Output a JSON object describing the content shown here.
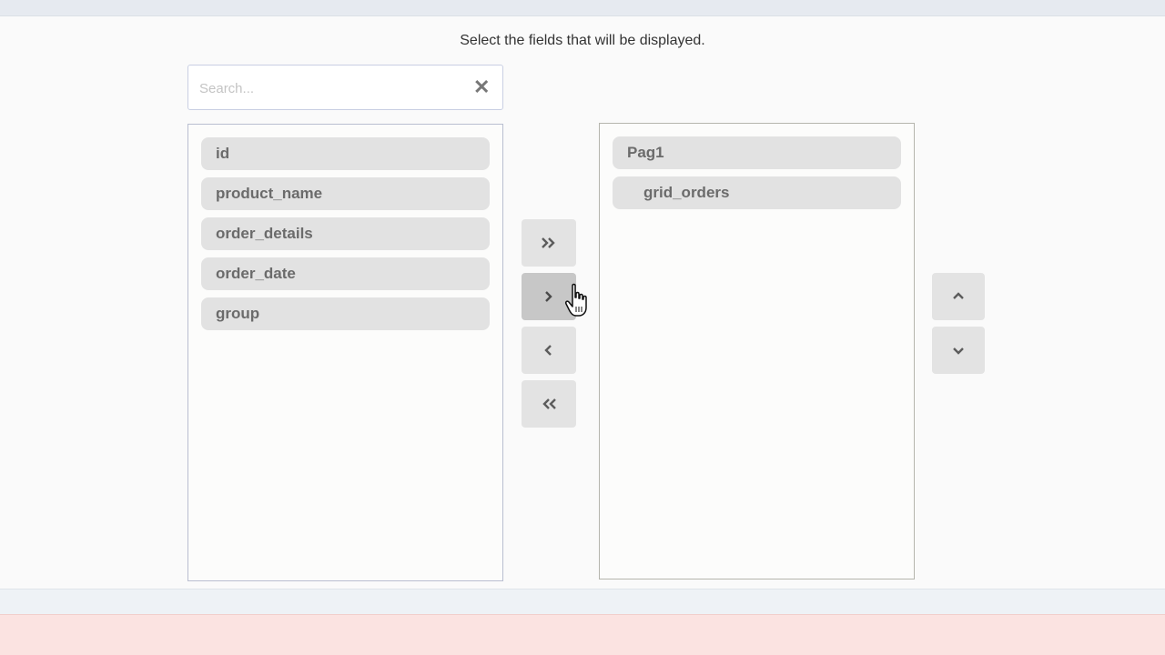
{
  "header": {
    "instruction": "Select the fields that will be displayed."
  },
  "search": {
    "placeholder": "Search...",
    "value": "",
    "clear_icon": "close-icon"
  },
  "available_fields": [
    {
      "label": "id"
    },
    {
      "label": "product_name"
    },
    {
      "label": "order_details"
    },
    {
      "label": "order_date"
    },
    {
      "label": "group"
    }
  ],
  "selected_fields": [
    {
      "label": "Pag1",
      "level": 0
    },
    {
      "label": "grid_orders",
      "level": 1
    }
  ],
  "transfer_buttons": [
    {
      "name": "move-all-right",
      "icon": "double-chevron-right-icon"
    },
    {
      "name": "move-right",
      "icon": "chevron-right-icon"
    },
    {
      "name": "move-left",
      "icon": "chevron-left-icon"
    },
    {
      "name": "move-all-left",
      "icon": "double-chevron-left-icon"
    }
  ],
  "order_buttons": [
    {
      "name": "move-up",
      "icon": "chevron-up-icon"
    },
    {
      "name": "move-down",
      "icon": "chevron-down-icon"
    }
  ],
  "colors": {
    "background": "#fafafa",
    "item_bg": "#e2e2e2",
    "item_text": "#6b6b6b",
    "button_bg": "#e3e3e3",
    "button_active_bg": "#c7c7c7",
    "footer_pink": "#fbe3e1"
  }
}
